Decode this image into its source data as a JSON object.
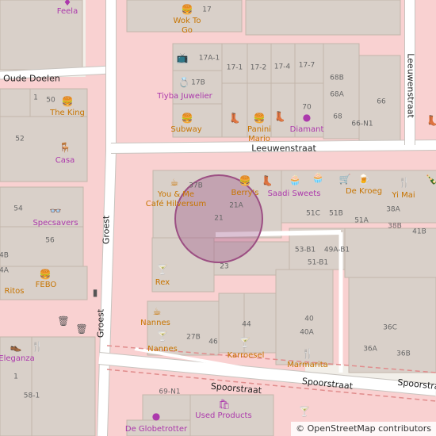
{
  "colors": {
    "background": "#f2efe9",
    "pedestrian_area": "#f9d1d1",
    "building": "#d9d0c9",
    "building_outline": "#c4b6ab",
    "road": "#ffffff",
    "road_casing": "#c8c4bf",
    "railway": "#e08c8c",
    "marker_fill": "#9c4f83",
    "poi_shop": "#ac39ac",
    "poi_food": "#c77400"
  },
  "streets": {
    "oude_doelen": "Oude Doelen",
    "groest_upper": "Groest",
    "groest_lower": "Groest",
    "leeuwenstraat": "Leeuwenstraat",
    "leeuwenstraat_vertical": "Leeuwenstraat",
    "spoorstraat_main": "Spoorstraat",
    "spoorstraat_lower": "Spoorstraat",
    "spoorstraat_right": "Spoorstra"
  },
  "pois": {
    "feela": "Feela",
    "wok_to_go_1": "Wok To",
    "wok_to_go_2": "Go",
    "the_king": "The King",
    "casa": "Casa",
    "tiyba": "Tiyba Juwelier",
    "subway": "Subway",
    "panini_1": "Panini",
    "panini_2": "Mario",
    "diamant": "Diamant",
    "you_and_me_1": "You & Me",
    "you_and_me_2": "Café Hilversum",
    "berrys": "Berry's",
    "saadi": "Saadi Sweets",
    "de_kroeg": "De Kroeg",
    "yi_mai": "Yi Mai",
    "specsavers": "Specsavers",
    "febo": "FEBO",
    "ritos": "Ritos",
    "rex": "Rex",
    "nannes_1": "Nannes",
    "nannes_2": "Nannes",
    "karroesel": "Karroesel",
    "marmarita": "Marmarita",
    "eleganza": "Eleganza",
    "used_products": "Used Products",
    "de_globetrotter": "De Globetrotter"
  },
  "housenumbers": {
    "n17": "17",
    "n17a1": "17A-1",
    "n17_1": "17-1",
    "n17_2": "17-2",
    "n17_4": "17-4",
    "n17_7": "17-7",
    "n17b": "17B",
    "n68b": "68B",
    "n68a": "68A",
    "n66": "66",
    "n70": "70",
    "n68": "68",
    "n66n1": "66-N1",
    "n1": "1",
    "n50": "50",
    "n52": "52",
    "n54": "54",
    "n56": "56",
    "n4b": "4B",
    "n4a": "4A",
    "n37b": "37B",
    "n21a": "21A",
    "n21": "21",
    "n51c": "51C",
    "n51b": "51B",
    "n51a": "51A",
    "n38a": "38A",
    "n38b": "38B",
    "n41b": "41B",
    "n53b1": "53-B1",
    "n49ab1": "49A-B1",
    "n51b1": "51-B1",
    "n23": "23",
    "n44": "44",
    "n40": "40",
    "n40a": "40A",
    "n36c": "36C",
    "n36a": "36A",
    "n36b": "36B",
    "n27b": "27B",
    "n46": "46",
    "n1b": "1",
    "n58_1": "58-1",
    "n69n1": "69-N1"
  },
  "marker": {
    "type": "location-circle"
  },
  "attribution": {
    "symbol": "©",
    "text": "OpenStreetMap contributors"
  }
}
